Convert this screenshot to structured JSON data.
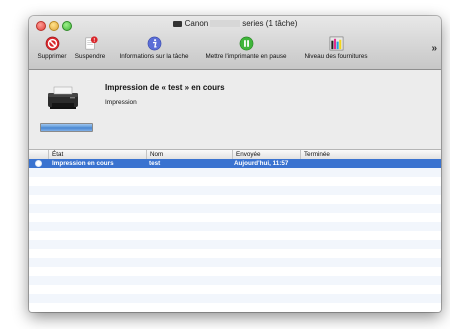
{
  "window": {
    "title_prefix": "Canon",
    "title_suffix": "series (1 tâche)"
  },
  "toolbar": {
    "items": [
      {
        "label": "Supprimer",
        "icon": "delete-icon",
        "color": "#d9262b"
      },
      {
        "label": "Suspendre",
        "icon": "suspend-icon",
        "color": "#d9262b"
      },
      {
        "label": "Informations sur la tâche",
        "icon": "info-icon",
        "color": "#5b6ed6"
      },
      {
        "label": "Mettre l'imprimante en pause",
        "icon": "pause-icon",
        "color": "#3fb53a"
      },
      {
        "label": "Niveau des fournitures",
        "icon": "ink-levels-icon"
      }
    ],
    "overflow_label": "»"
  },
  "job": {
    "title": "Impression de « test » en cours",
    "status": "Impression",
    "progress": 1.0,
    "icon": "printer-icon"
  },
  "table": {
    "columns": [
      "État",
      "Nom",
      "Envoyée",
      "Terminée"
    ],
    "rows": [
      {
        "etat": "Impression en cours",
        "nom": "test",
        "envoyee": "Aujourd'hui, 11:57",
        "terminee": "",
        "selected": true
      }
    ]
  },
  "colors": {
    "selection": "#3a73d0",
    "progress": "#4582cf"
  }
}
